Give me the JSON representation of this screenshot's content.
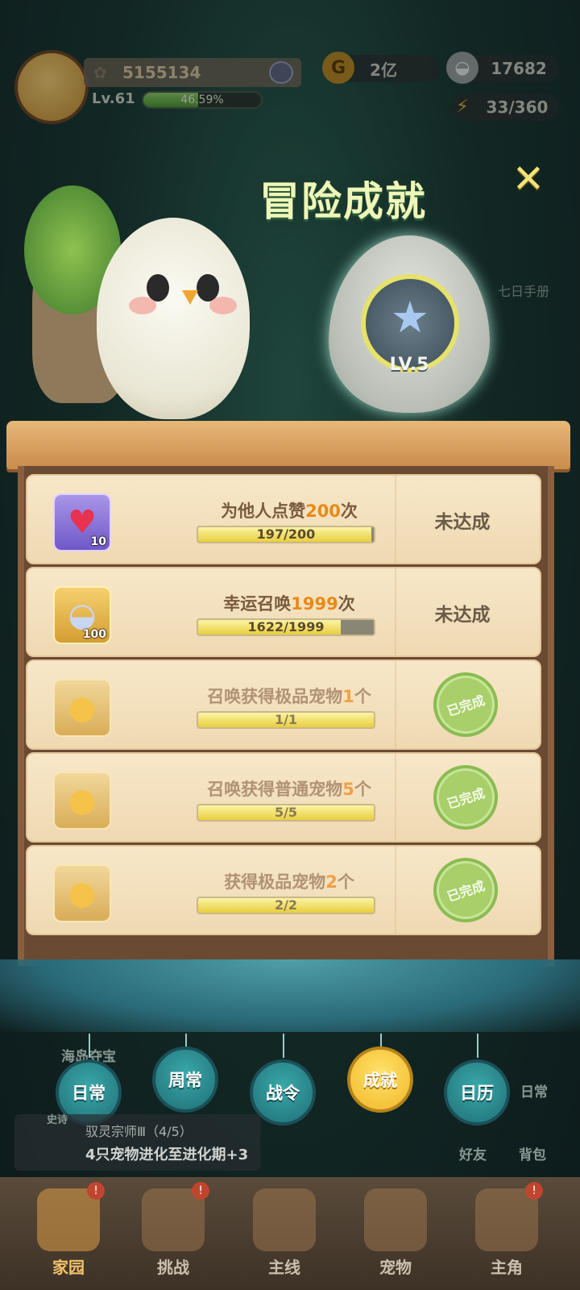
{
  "hud": {
    "player_id": "5155134",
    "level": "Lv.61",
    "xp_percent_label": "46.59%",
    "xp_fraction": 0.4659,
    "gold": "2亿",
    "shells": "17682",
    "energy": "33/360"
  },
  "banner": {
    "title": "冒险成就",
    "medal_level": "LV.5",
    "close_icon": "close-icon"
  },
  "tasks": [
    {
      "title_pre": "为他人点赞",
      "title_num": "200",
      "title_post": "次",
      "progress_label": "197/200",
      "progress": 0.985,
      "reward_icon": "heart-icon",
      "reward_count": "10",
      "status": "未达成",
      "done": false
    },
    {
      "title_pre": "幸运召唤",
      "title_num": "1999",
      "title_post": "次",
      "progress_label": "1622/1999",
      "progress": 0.811,
      "reward_icon": "shell-icon",
      "reward_count": "100",
      "status": "未达成",
      "done": false
    },
    {
      "title_pre": "召唤获得极品宠物",
      "title_num": "1",
      "title_post": "个",
      "progress_label": "1/1",
      "progress": 1.0,
      "reward_icon": "egg-icon",
      "reward_count": "",
      "status": "已完成",
      "done": true
    },
    {
      "title_pre": "召唤获得普通宠物",
      "title_num": "5",
      "title_post": "个",
      "progress_label": "5/5",
      "progress": 1.0,
      "reward_icon": "egg-icon",
      "reward_count": "",
      "status": "已完成",
      "done": true
    },
    {
      "title_pre": "获得极品宠物",
      "title_num": "2",
      "title_post": "个",
      "progress_label": "2/2",
      "progress": 1.0,
      "reward_icon": "egg-icon",
      "reward_count": "",
      "status": "已完成",
      "done": true
    }
  ],
  "tabs": [
    {
      "label": "日常",
      "active": false
    },
    {
      "label": "周常",
      "active": false
    },
    {
      "label": "战令",
      "active": false
    },
    {
      "label": "成就",
      "active": true
    },
    {
      "label": "日历",
      "active": false
    }
  ],
  "background": {
    "event_label": "海岛夺宝",
    "quest_tag": "史诗",
    "quest_title": "驭灵宗师Ⅲ（4/5）",
    "quest_desc": "4只宠物进化至进化期+3",
    "right_daily": "日常",
    "friends": "好友",
    "bag": "背包",
    "seven_day": "七日手册"
  },
  "navbar": [
    {
      "label": "家园",
      "badge": "!"
    },
    {
      "label": "挑战",
      "badge": "!"
    },
    {
      "label": "主线",
      "badge": ""
    },
    {
      "label": "宠物",
      "badge": ""
    },
    {
      "label": "主角",
      "badge": "!"
    }
  ],
  "colors": {
    "accent_orange": "#e88a16",
    "complete_green": "#a9cf6a",
    "tab_teal": "#1f6f77",
    "tab_active_yellow": "#f2b62a"
  }
}
